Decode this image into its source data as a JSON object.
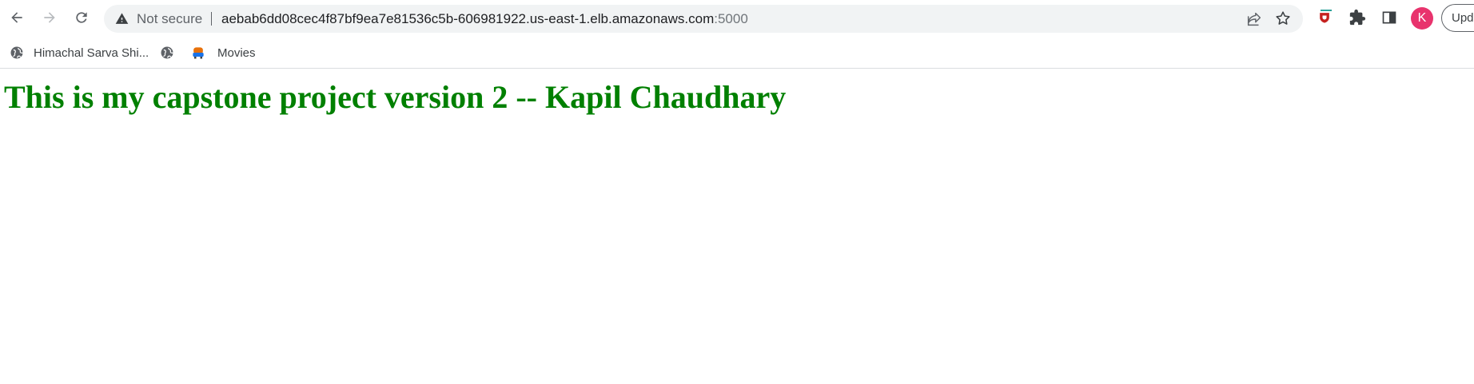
{
  "browser": {
    "security_label": "Not secure",
    "url_host": "aebab6dd08cec4f87bf9ea7e81536c5b-606981922.us-east-1.elb.amazonaws.com",
    "url_port": ":5000",
    "avatar_initial": "K",
    "update_label": "Update",
    "icons": {
      "back": "back-arrow-icon",
      "forward": "forward-arrow-icon",
      "reload": "reload-icon",
      "warning": "warning-icon",
      "share": "share-icon",
      "star": "bookmark-star-icon",
      "extension": "shield-extension-icon",
      "extensions": "puzzle-icon",
      "side_panel": "side-panel-icon"
    },
    "colors": {
      "avatar": "#e8336d",
      "omnibox": "#f1f3f4"
    }
  },
  "bookmarks": [
    {
      "label": "Himachal Sarva Shi...",
      "icon": "globe-icon"
    },
    {
      "label": "",
      "icon": "globe-icon"
    },
    {
      "label": "Movies",
      "icon": "movies-icon"
    }
  ],
  "page": {
    "heading": "This is my capstone project version 2 -- Kapil Chaudhary",
    "heading_color": "#008000"
  }
}
